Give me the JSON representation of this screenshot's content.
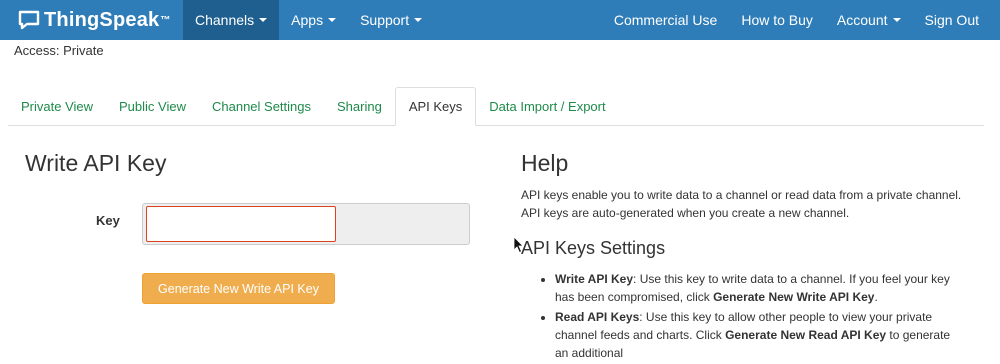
{
  "navbar": {
    "brand": "ThingSpeak",
    "brand_tm": "™",
    "left_items": [
      {
        "label": "Channels",
        "dropdown": true,
        "active": true
      },
      {
        "label": "Apps",
        "dropdown": true
      },
      {
        "label": "Support",
        "dropdown": true
      }
    ],
    "right_items": [
      {
        "label": "Commercial Use"
      },
      {
        "label": "How to Buy"
      },
      {
        "label": "Account",
        "dropdown": true
      },
      {
        "label": "Sign Out"
      }
    ]
  },
  "access": "Access: Private",
  "tabs": [
    {
      "label": "Private View"
    },
    {
      "label": "Public View"
    },
    {
      "label": "Channel Settings"
    },
    {
      "label": "Sharing"
    },
    {
      "label": "API Keys",
      "active": true
    },
    {
      "label": "Data Import / Export"
    }
  ],
  "write_key": {
    "title": "Write API Key",
    "key_label": "Key",
    "key_value": "",
    "generate_button": "Generate New Write API Key"
  },
  "help": {
    "title": "Help",
    "description": "API keys enable you to write data to a channel or read data from a private channel. API keys are auto-generated when you create a new channel.",
    "settings_title": "API Keys Settings",
    "settings": [
      {
        "term": "Write API Key",
        "text_before": ": Use this key to write data to a channel. If you feel your key has been compromised, click ",
        "action": "Generate New Write API Key",
        "text_after": "."
      },
      {
        "term": "Read API Keys",
        "text_before": ": Use this key to allow other people to view your private channel feeds and charts. Click ",
        "action": "Generate New Read API Key",
        "text_after": " to generate an additional"
      }
    ]
  },
  "colors": {
    "navbar_bg": "#2f7db8",
    "navbar_active": "#1f5f8f",
    "tab_link": "#1e8a4a",
    "button_warning": "#f0ad4e",
    "input_border_error": "#d9441e"
  }
}
